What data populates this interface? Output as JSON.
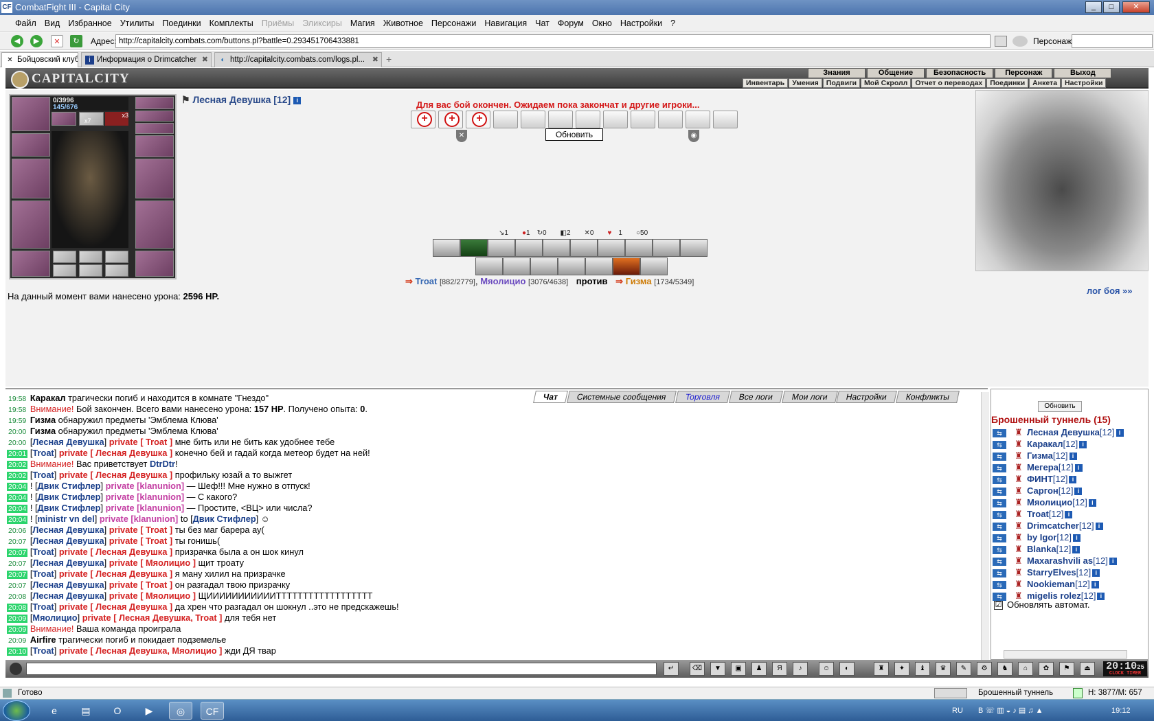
{
  "window": {
    "title": "CombatFight III - Capital City",
    "logo": "CF"
  },
  "menu": [
    "Файл",
    "Вид",
    "Избранное",
    "Утилиты",
    "Поединки",
    "Комплекты",
    "Приёмы",
    "Эликсиры",
    "Магия",
    "Животное",
    "Персонажи",
    "Навигация",
    "Чат",
    "Форум",
    "Окно",
    "Настройки",
    "?"
  ],
  "menu_disabled": [
    "Приёмы",
    "Эликсиры"
  ],
  "address": {
    "label": "Адрес:",
    "url": "http://capitalcity.combats.com/buttons.pl?battle=0.293451706433881",
    "char_label": "Персонаж:"
  },
  "tabs": [
    {
      "label": "Бойцовский клуб",
      "active": true
    },
    {
      "label": "Информация о Drimcatcher",
      "active": false
    },
    {
      "label": "http://capitalcity.combats.com/logs.pl...",
      "active": false
    }
  ],
  "game": {
    "logo": "CAPITALCITY",
    "topnav": [
      "Знания",
      "Общение",
      "Безопасность",
      "Персонаж",
      "Выход"
    ],
    "subnav": [
      "Инвентарь",
      "Умения",
      "Подвиги",
      "Мой Скролл",
      "Отчет о переводах",
      "Поединки",
      "Анкета",
      "Настройки"
    ]
  },
  "battle": {
    "hp_line1": "0/3996",
    "hp_line2": "145/676",
    "badge_x7": "x7",
    "badge_x3": "x3",
    "player_name": "Лесная Девушка [12]",
    "info_icon": "i",
    "finished_msg": "Для вас бой окончен. Ожидаем пока закончат и другие игроки...",
    "refresh_label": "Обновить",
    "stats": [
      "1",
      "1",
      "0",
      "2",
      "0",
      "1",
      "50"
    ],
    "team1": [
      {
        "name": "Troat",
        "hp": "[882/2779]"
      },
      {
        "name": "Мяолицио",
        "hp": "[3076/4638]"
      }
    ],
    "vs": "против",
    "team2": [
      {
        "name": "Гизма",
        "hp": "[1734/5349]"
      }
    ],
    "damage_label": "На данный момент вами нанесено урона:",
    "damage_value": "2596 HP.",
    "log_link": "лог боя »»"
  },
  "chat": {
    "tabs": [
      "Чат",
      "Системные сообщения",
      "Торговля",
      "Все логи",
      "Мои логи",
      "Настройки",
      "Конфликты"
    ],
    "lines": [
      {
        "t": "19:58",
        "hl": false,
        "parts": [
          {
            "c": "bold",
            "v": "Каракал"
          },
          {
            "c": "",
            "v": " трагически погиб и находится в комнате \"Гнездо\""
          }
        ]
      },
      {
        "t": "19:58",
        "hl": false,
        "parts": [
          {
            "c": "warn",
            "v": "Внимание!"
          },
          {
            "c": "",
            "v": " Бой закончен. Всего вами нанесено урона: "
          },
          {
            "c": "bold",
            "v": "157 HP"
          },
          {
            "c": "",
            "v": ". Получено опыта: "
          },
          {
            "c": "bold",
            "v": "0"
          },
          {
            "c": "",
            "v": "."
          }
        ]
      },
      {
        "t": "19:59",
        "hl": false,
        "parts": [
          {
            "c": "bold",
            "v": "Гизма"
          },
          {
            "c": "",
            "v": " обнаружил предметы 'Эмблема Клюва'"
          }
        ]
      },
      {
        "t": "20:00",
        "hl": false,
        "parts": [
          {
            "c": "bold",
            "v": "Гизма"
          },
          {
            "c": "",
            "v": " обнаружил предметы 'Эмблема Клюва'"
          }
        ]
      },
      {
        "t": "20:00",
        "hl": false,
        "parts": [
          {
            "c": "",
            "v": "["
          },
          {
            "c": "sender",
            "v": "Лесная Девушка"
          },
          {
            "c": "",
            "v": "] "
          },
          {
            "c": "priv",
            "v": "private [ Troat ]"
          },
          {
            "c": "",
            "v": " мне бить или не бить как удобнее тебе"
          }
        ]
      },
      {
        "t": "20:01",
        "hl": true,
        "parts": [
          {
            "c": "",
            "v": "["
          },
          {
            "c": "sender",
            "v": "Troat"
          },
          {
            "c": "",
            "v": "] "
          },
          {
            "c": "priv",
            "v": "private [ Лесная Девушка ]"
          },
          {
            "c": "",
            "v": " конечно бей и гадай когда метеор будет на ней!"
          }
        ]
      },
      {
        "t": "20:02",
        "hl": true,
        "parts": [
          {
            "c": "warn",
            "v": "Внимание!"
          },
          {
            "c": "",
            "v": " Вас приветствует "
          },
          {
            "c": "sender",
            "v": "DtrDtr"
          },
          {
            "c": "",
            "v": "!"
          }
        ]
      },
      {
        "t": "20:02",
        "hl": true,
        "parts": [
          {
            "c": "",
            "v": "["
          },
          {
            "c": "sender",
            "v": "Troat"
          },
          {
            "c": "",
            "v": "] "
          },
          {
            "c": "priv",
            "v": "private [ Лесная Девушка ]"
          },
          {
            "c": "",
            "v": " профильку юзай а то выжгет"
          }
        ]
      },
      {
        "t": "20:04",
        "hl": true,
        "parts": [
          {
            "c": "",
            "v": "! ["
          },
          {
            "c": "sender",
            "v": "Двик Стифлер"
          },
          {
            "c": "",
            "v": "] "
          },
          {
            "c": "pinkn",
            "v": "private [klanunion]"
          },
          {
            "c": "",
            "v": " — Шеф!!! Мне нужно в отпуск!"
          }
        ]
      },
      {
        "t": "20:04",
        "hl": true,
        "parts": [
          {
            "c": "",
            "v": "! ["
          },
          {
            "c": "sender",
            "v": "Двик Стифлер"
          },
          {
            "c": "",
            "v": "] "
          },
          {
            "c": "pinkn",
            "v": "private [klanunion]"
          },
          {
            "c": "",
            "v": " — С какого?"
          }
        ]
      },
      {
        "t": "20:04",
        "hl": true,
        "parts": [
          {
            "c": "",
            "v": "! ["
          },
          {
            "c": "sender",
            "v": "Двик Стифлер"
          },
          {
            "c": "",
            "v": "] "
          },
          {
            "c": "pinkn",
            "v": "private [klanunion]"
          },
          {
            "c": "",
            "v": " — Простите, <ВЦ> или числа?"
          }
        ]
      },
      {
        "t": "20:04",
        "hl": true,
        "parts": [
          {
            "c": "",
            "v": "! ["
          },
          {
            "c": "sender",
            "v": "ministr vn del"
          },
          {
            "c": "",
            "v": "] "
          },
          {
            "c": "pinkn",
            "v": "private [klanunion]"
          },
          {
            "c": "",
            "v": " to ["
          },
          {
            "c": "sender",
            "v": "Двик Стифлер"
          },
          {
            "c": "",
            "v": "] ☺"
          }
        ]
      },
      {
        "t": "20:06",
        "hl": false,
        "parts": [
          {
            "c": "",
            "v": "["
          },
          {
            "c": "sender",
            "v": "Лесная Девушка"
          },
          {
            "c": "",
            "v": "] "
          },
          {
            "c": "priv",
            "v": "private [ Troat ]"
          },
          {
            "c": "",
            "v": " ты без маг барера ау("
          }
        ]
      },
      {
        "t": "20:07",
        "hl": false,
        "parts": [
          {
            "c": "",
            "v": "["
          },
          {
            "c": "sender",
            "v": "Лесная Девушка"
          },
          {
            "c": "",
            "v": "] "
          },
          {
            "c": "priv",
            "v": "private [ Troat ]"
          },
          {
            "c": "",
            "v": " ты гонишь("
          }
        ]
      },
      {
        "t": "20:07",
        "hl": true,
        "parts": [
          {
            "c": "",
            "v": "["
          },
          {
            "c": "sender",
            "v": "Troat"
          },
          {
            "c": "",
            "v": "] "
          },
          {
            "c": "priv",
            "v": "private [ Лесная Девушка ]"
          },
          {
            "c": "",
            "v": " призрачка была а он шок кинул"
          }
        ]
      },
      {
        "t": "20:07",
        "hl": false,
        "parts": [
          {
            "c": "",
            "v": "["
          },
          {
            "c": "sender",
            "v": "Лесная Девушка"
          },
          {
            "c": "",
            "v": "] "
          },
          {
            "c": "priv",
            "v": "private [ Мяолицио ]"
          },
          {
            "c": "",
            "v": " щит троату"
          }
        ]
      },
      {
        "t": "20:07",
        "hl": true,
        "parts": [
          {
            "c": "",
            "v": "["
          },
          {
            "c": "sender",
            "v": "Troat"
          },
          {
            "c": "",
            "v": "] "
          },
          {
            "c": "priv",
            "v": "private [ Лесная Девушка ]"
          },
          {
            "c": "",
            "v": " я ману хилил на призрачке"
          }
        ]
      },
      {
        "t": "20:07",
        "hl": false,
        "parts": [
          {
            "c": "",
            "v": "["
          },
          {
            "c": "sender",
            "v": "Лесная Девушка"
          },
          {
            "c": "",
            "v": "] "
          },
          {
            "c": "priv",
            "v": "private [ Troat ]"
          },
          {
            "c": "",
            "v": " он разгадал твою призрачку"
          }
        ]
      },
      {
        "t": "20:08",
        "hl": false,
        "parts": [
          {
            "c": "",
            "v": "["
          },
          {
            "c": "sender",
            "v": "Лесная Девушка"
          },
          {
            "c": "",
            "v": "] "
          },
          {
            "c": "priv",
            "v": "private [ Мяолицио ]"
          },
          {
            "c": "",
            "v": " ЩИИИИИИИИИИИТТТТТТТТТТТТТТТТТТ"
          }
        ]
      },
      {
        "t": "20:08",
        "hl": true,
        "parts": [
          {
            "c": "",
            "v": "["
          },
          {
            "c": "sender",
            "v": "Troat"
          },
          {
            "c": "",
            "v": "] "
          },
          {
            "c": "priv",
            "v": "private [ Лесная Девушка ]"
          },
          {
            "c": "",
            "v": " да хрен что разгадал он шокнул ..это не предскажешь!"
          }
        ]
      },
      {
        "t": "20:09",
        "hl": true,
        "parts": [
          {
            "c": "",
            "v": "["
          },
          {
            "c": "sender",
            "v": "Мяолицио"
          },
          {
            "c": "",
            "v": "] "
          },
          {
            "c": "priv",
            "v": "private [ Лесная Девушка, Troat ]"
          },
          {
            "c": "",
            "v": " для тебя нет"
          }
        ]
      },
      {
        "t": "20:09",
        "hl": true,
        "parts": [
          {
            "c": "warn",
            "v": "Внимание!"
          },
          {
            "c": "",
            "v": " Ваша команда проиграла"
          }
        ]
      },
      {
        "t": "20:09",
        "hl": false,
        "parts": [
          {
            "c": "bold",
            "v": "Airfire"
          },
          {
            "c": "",
            "v": " трагически погиб и покидает подземелье"
          }
        ]
      },
      {
        "t": "20:10",
        "hl": true,
        "parts": [
          {
            "c": "",
            "v": "["
          },
          {
            "c": "sender",
            "v": "Troat"
          },
          {
            "c": "",
            "v": "] "
          },
          {
            "c": "priv",
            "v": "private [ Лесная Девушка, Мяолицио ]"
          },
          {
            "c": "",
            "v": " жди ДЯ твар"
          }
        ]
      }
    ]
  },
  "sidebar": {
    "refresh_label": "Обновить",
    "room": "Брошенный туннель (15)",
    "players": [
      {
        "name": "Лесная Девушка",
        "lvl": "[12]"
      },
      {
        "name": "Каракал",
        "lvl": "[12]"
      },
      {
        "name": "Гизма",
        "lvl": "[12]"
      },
      {
        "name": "Мегера",
        "lvl": "[12]"
      },
      {
        "name": "ФИНТ",
        "lvl": "[12]"
      },
      {
        "name": "Саргон",
        "lvl": "[12]"
      },
      {
        "name": "Мяолицио",
        "lvl": "[12]"
      },
      {
        "name": "Troat",
        "lvl": "[12]"
      },
      {
        "name": "Drimcatcher",
        "lvl": "[12]"
      },
      {
        "name": "by Igor",
        "lvl": "[12]"
      },
      {
        "name": "Blanka",
        "lvl": "[12]"
      },
      {
        "name": "Maxarashvili as",
        "lvl": "[12]"
      },
      {
        "name": "StarryElves",
        "lvl": "[12]"
      },
      {
        "name": "Nookieman",
        "lvl": "[12]"
      },
      {
        "name": "migelis rolez",
        "lvl": "[12]"
      }
    ],
    "auto_label": "Обновлять автомат.",
    "auto_checked": "☑"
  },
  "clock": {
    "time": "20:10",
    "sec": "25",
    "sub": "CLOCK TIMER"
  },
  "statusbar": {
    "status": "Готово",
    "location": "Брошенный туннель",
    "hm": "H: 3877/M: 657"
  },
  "taskbar": {
    "lang": "RU",
    "time": "19:12"
  }
}
